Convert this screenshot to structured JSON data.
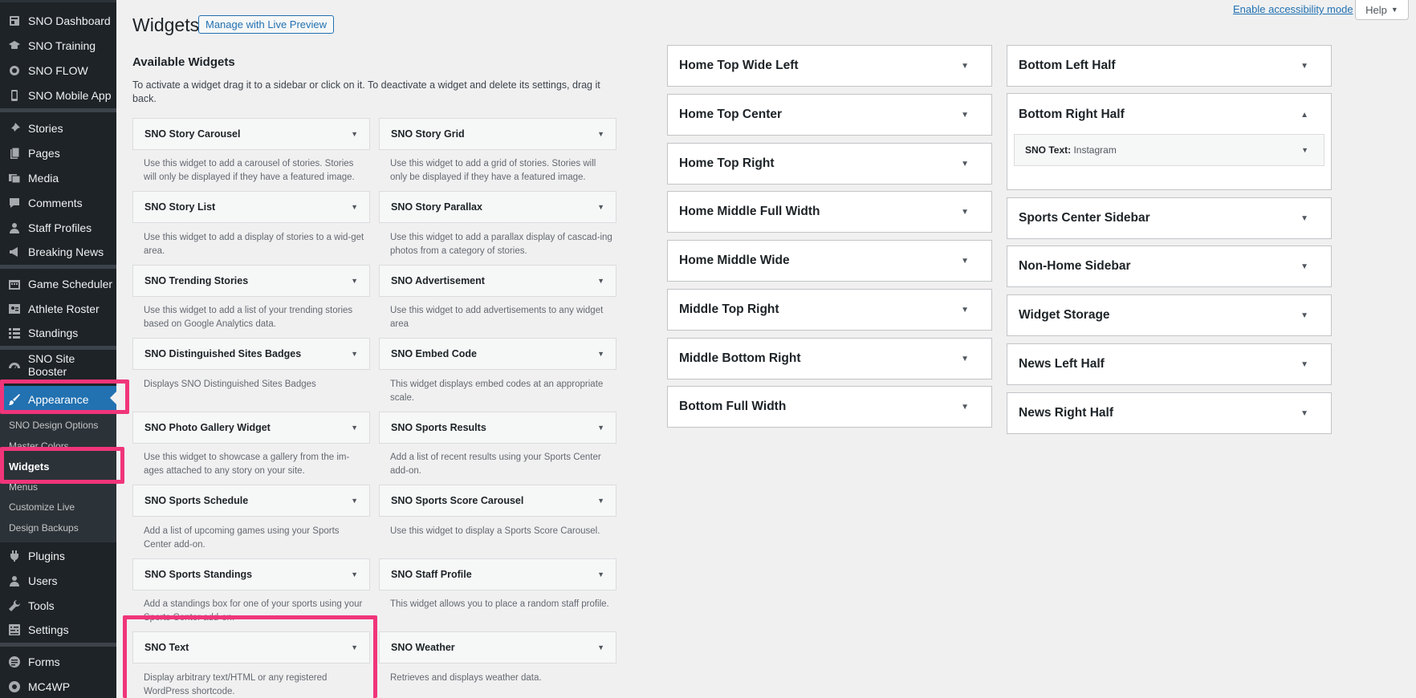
{
  "sidebar": {
    "top_items": [
      {
        "label": "SNO Dashboard",
        "icon": "dashboard-icon"
      },
      {
        "label": "SNO Training",
        "icon": "training-icon"
      },
      {
        "label": "SNO FLOW",
        "icon": "flow-icon"
      },
      {
        "label": "SNO Mobile App",
        "icon": "mobile-icon"
      }
    ],
    "content_items": [
      {
        "label": "Stories",
        "icon": "pin-icon"
      },
      {
        "label": "Pages",
        "icon": "pages-icon"
      },
      {
        "label": "Media",
        "icon": "media-icon"
      },
      {
        "label": "Comments",
        "icon": "comments-icon"
      },
      {
        "label": "Staff Profiles",
        "icon": "user-icon"
      },
      {
        "label": "Breaking News",
        "icon": "megaphone-icon"
      }
    ],
    "sports_items": [
      {
        "label": "Game Scheduler",
        "icon": "calendar-icon"
      },
      {
        "label": "Athlete Roster",
        "icon": "roster-icon"
      },
      {
        "label": "Standings",
        "icon": "list-icon"
      }
    ],
    "booster": {
      "label": "SNO Site Booster",
      "icon": "gauge-icon"
    },
    "appearance": {
      "label": "Appearance",
      "icon": "brush-icon"
    },
    "submenu": [
      {
        "label": "SNO Design Options"
      },
      {
        "label": "Master Colors"
      },
      {
        "label": "Widgets"
      },
      {
        "label": "Menus"
      },
      {
        "label": "Customize Live"
      },
      {
        "label": "Design Backups"
      }
    ],
    "bottom_items": [
      {
        "label": "Plugins",
        "icon": "plugin-icon"
      },
      {
        "label": "Users",
        "icon": "users-icon"
      },
      {
        "label": "Tools",
        "icon": "wrench-icon"
      },
      {
        "label": "Settings",
        "icon": "settings-icon"
      }
    ],
    "extra_items": [
      {
        "label": "Forms",
        "icon": "forms-icon"
      },
      {
        "label": "MC4WP",
        "icon": "mail-icon"
      }
    ]
  },
  "topbar": {
    "accessibility_link": "Enable accessibility mode",
    "help_label": "Help"
  },
  "header": {
    "title": "Widgets",
    "live_preview_label": "Manage with Live Preview"
  },
  "available": {
    "title": "Available Widgets",
    "description": "To activate a widget drag it to a sidebar or click on it. To deactivate a widget and delete its settings, drag it back.",
    "widgets": [
      {
        "name": "SNO Story Carousel",
        "desc": "Use this widget to add a carousel of stories. Stories will only be displayed if they have a featured image."
      },
      {
        "name": "SNO Story Grid",
        "desc": "Use this widget to add a grid of stories. Stories will only be displayed if they have a featured image."
      },
      {
        "name": "SNO Story List",
        "desc": "Use this widget to add a display of stories to a wid-get area."
      },
      {
        "name": "SNO Story Parallax",
        "desc": "Use this widget to add a parallax display of cascad-ing photos from a category of stories."
      },
      {
        "name": "SNO Trending Stories",
        "desc": "Use this widget to add a list of your trending stories based on Google Analytics data."
      },
      {
        "name": "SNO Advertisement",
        "desc": "Use this widget to add advertisements to any widget area"
      },
      {
        "name": "SNO Distinguished Sites Badges",
        "desc": "Displays SNO Distinguished Sites Badges"
      },
      {
        "name": "SNO Embed Code",
        "desc": "This widget displays embed codes at an appropriate scale."
      },
      {
        "name": "SNO Photo Gallery Widget",
        "desc": "Use this widget to showcase a gallery from the im-ages attached to any story on your site."
      },
      {
        "name": "SNO Sports Results",
        "desc": "Add a list of recent results using your Sports Center add-on."
      },
      {
        "name": "SNO Sports Schedule",
        "desc": "Add a list of upcoming games using your Sports Center add-on."
      },
      {
        "name": "SNO Sports Score Carousel",
        "desc": "Use this widget to display a Sports Score Carousel."
      },
      {
        "name": "SNO Sports Standings",
        "desc": "Add a standings box for one of your sports using your Sports Center add-on."
      },
      {
        "name": "SNO Staff Profile",
        "desc": "This widget allows you to place a random staff profile."
      },
      {
        "name": "SNO Text",
        "desc": "Display arbitrary text/HTML or any registered WordPress shortcode."
      },
      {
        "name": "SNO Weather",
        "desc": "Retrieves and displays weather data."
      }
    ]
  },
  "sidebars_left": [
    {
      "name": "Home Top Wide Left"
    },
    {
      "name": "Home Top Center"
    },
    {
      "name": "Home Top Right"
    },
    {
      "name": "Home Middle Full Width"
    },
    {
      "name": "Home Middle Wide"
    },
    {
      "name": "Middle Top Right"
    },
    {
      "name": "Middle Bottom Right"
    },
    {
      "name": "Bottom Full Width"
    }
  ],
  "sidebars_right": [
    {
      "name": "Bottom Left Half"
    },
    {
      "name": "Bottom Right Half",
      "expanded": true,
      "widget": {
        "name": "SNO Text:",
        "title": "Instagram"
      }
    },
    {
      "name": "Sports Center Sidebar"
    },
    {
      "name": "Non-Home Sidebar"
    },
    {
      "name": "Widget Storage"
    },
    {
      "name": "News Left Half"
    },
    {
      "name": "News Right Half"
    }
  ],
  "colors": {
    "sidebar_bg": "#1d2327",
    "accent": "#2271b1",
    "highlight": "#f0357a"
  }
}
